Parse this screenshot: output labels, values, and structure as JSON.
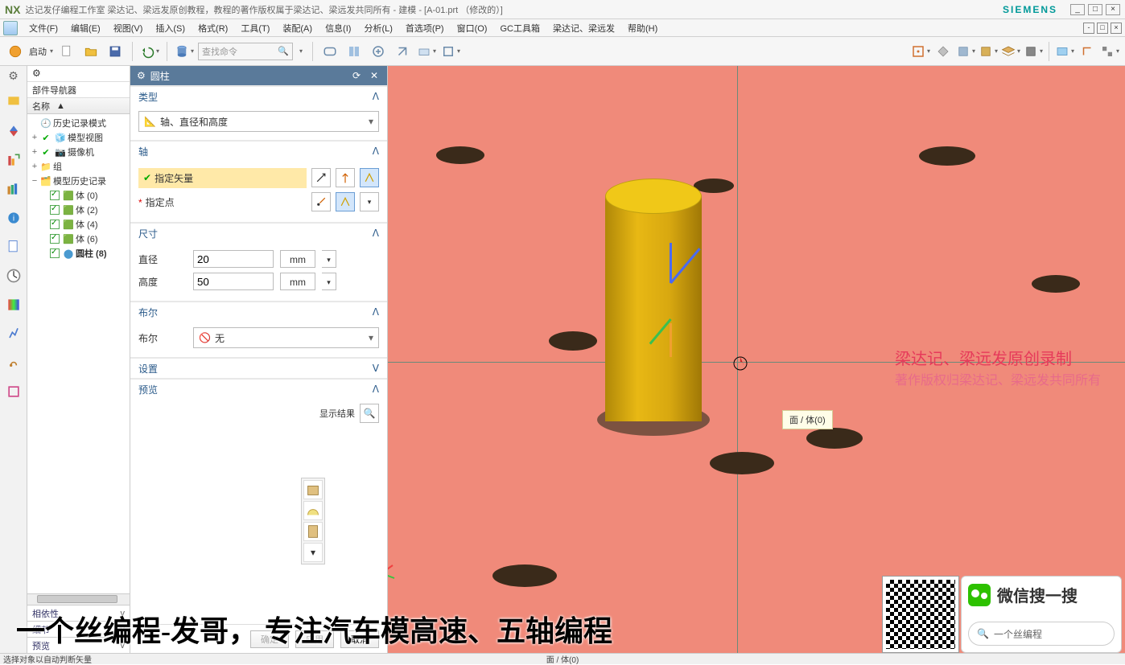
{
  "titlebar": {
    "logo": "NX",
    "title": "达记发仔编程工作室  梁达记、梁远发原创教程，教程的著作版权属于梁达记、梁远发共同所有 - 建模 - [A-01.prt （修改的）]",
    "brand": "SIEMENS"
  },
  "menu": {
    "items": [
      "文件(F)",
      "编辑(E)",
      "视图(V)",
      "插入(S)",
      "格式(R)",
      "工具(T)",
      "装配(A)",
      "信息(I)",
      "分析(L)",
      "首选项(P)",
      "窗口(O)",
      "GC工具箱",
      "梁达记、梁远发",
      "帮助(H)"
    ]
  },
  "toolbar": {
    "start": "启动",
    "search_placeholder": "查找命令"
  },
  "navigator": {
    "title": "部件导航器",
    "col_name": "名称",
    "nodes": {
      "history_mode": "历史记录模式",
      "model_view": "模型视图",
      "camera": "摄像机",
      "group": "组",
      "model_history": "模型历史记录",
      "body0": "体 (0)",
      "body2": "体 (2)",
      "body4": "体 (4)",
      "body6": "体 (6)",
      "cylinder8": "圆柱 (8)"
    },
    "tabs": {
      "dependency": "相依性",
      "detail": "细节",
      "preview": "预览"
    }
  },
  "dialog": {
    "title": "圆柱",
    "sections": {
      "type": "类型",
      "axis": "轴",
      "dim": "尺寸",
      "bool": "布尔",
      "settings": "设置",
      "preview": "预览"
    },
    "type_combo": "轴、直径和高度",
    "axis": {
      "vector": "指定矢量",
      "point": "指定点"
    },
    "dim": {
      "diameter_label": "直径",
      "diameter_value": "20",
      "height_label": "高度",
      "height_value": "50",
      "unit": "mm"
    },
    "bool": {
      "label": "布尔",
      "value": "无"
    },
    "preview_result": "显示结果",
    "buttons": {
      "ok": "确定",
      "apply": "应用",
      "cancel": "取消"
    }
  },
  "viewport": {
    "tooltip": "面 / 体(0)",
    "watermark_line1": "梁达记、梁远发原创录制",
    "watermark_line2": "著作版权归梁达记、梁远发共同所有"
  },
  "statusbar": {
    "left": "选择对象以自动判断矢量",
    "center": "面 / 体(0)"
  },
  "caption": "一个丝编程-发哥，   专注汽车模高速、五轴编程",
  "wechat": {
    "title": "微信搜一搜",
    "search": "一个丝编程"
  }
}
